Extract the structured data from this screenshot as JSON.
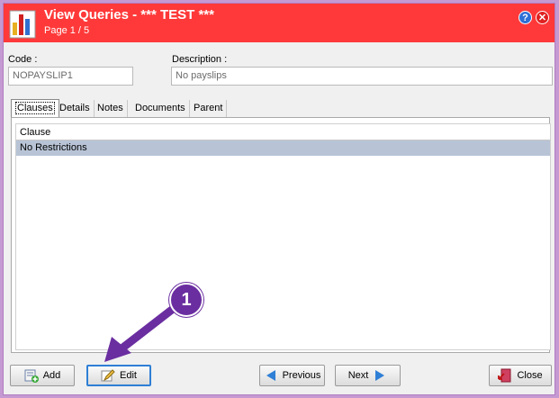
{
  "window": {
    "title": "View Queries - *** TEST ***",
    "subtitle": "Page 1 / 5",
    "help_glyph": "?",
    "close_glyph": "✕"
  },
  "form": {
    "code_label": "Code :",
    "code_value": "NOPAYSLIP1",
    "description_label": "Description :",
    "description_value": "No payslips"
  },
  "tabs": [
    "Clauses",
    "Details",
    "Notes",
    "Documents",
    "Parent"
  ],
  "grid": {
    "column_header": "Clause",
    "rows": [
      "No Restrictions"
    ]
  },
  "buttons": {
    "add": "Add",
    "edit": "Edit",
    "previous": "Previous",
    "next": "Next",
    "close": "Close"
  },
  "callout": {
    "number": "1"
  },
  "colors": {
    "titlebar": "#ff3939",
    "callout": "#6a2ea0",
    "selected_row": "#b8c4d6"
  },
  "icons": [
    "chart-icon",
    "help-icon",
    "close-icon",
    "add-icon",
    "edit-icon",
    "previous-arrow-icon",
    "next-arrow-icon",
    "close-door-icon"
  ]
}
